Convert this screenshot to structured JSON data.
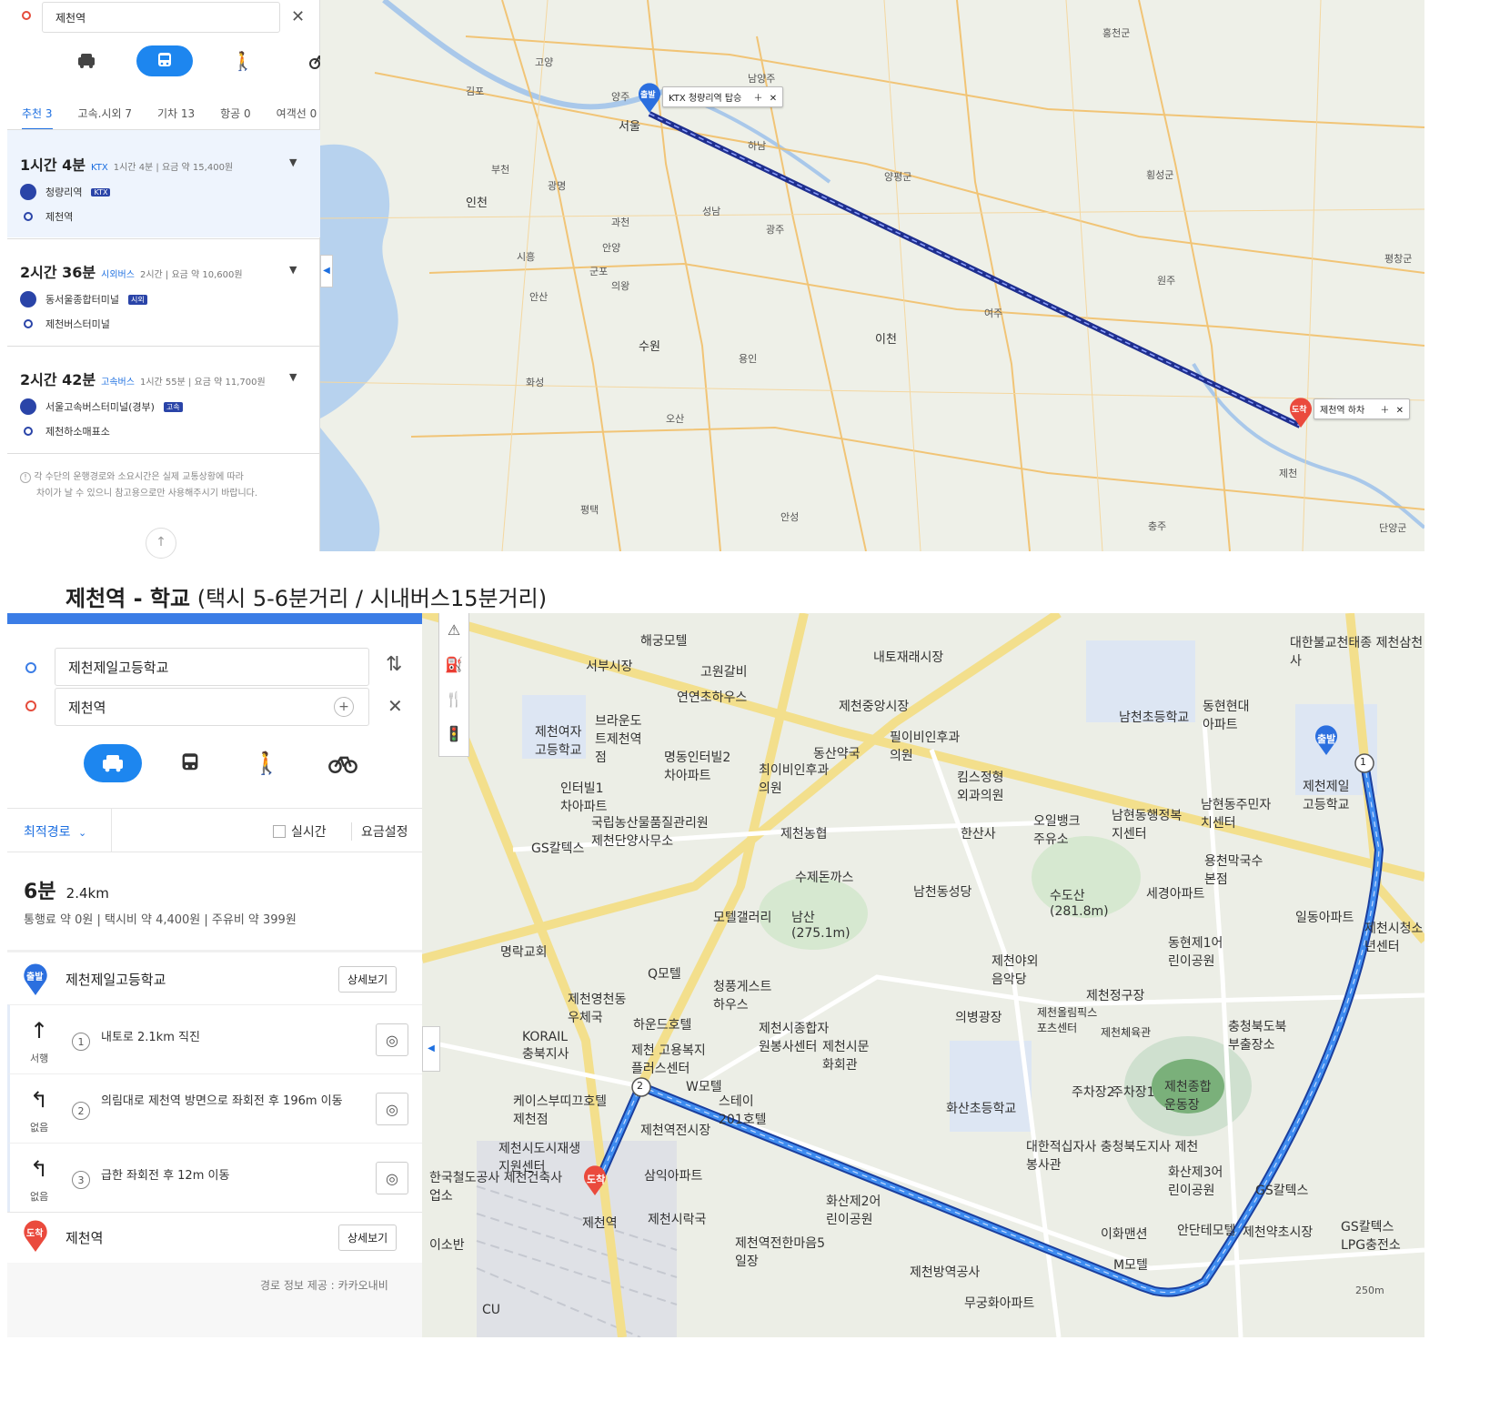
{
  "top": {
    "destination_value": "제천역",
    "tabs": [
      {
        "label": "추천 3"
      },
      {
        "label": "고속.시외 7"
      },
      {
        "label": "기차 13"
      },
      {
        "label": "항공 0"
      },
      {
        "label": "여객선 0"
      }
    ],
    "routes": [
      {
        "time": "1시간 4분",
        "kind": "KTX",
        "detail": "1시간 4분 | 요금 약 15,400원",
        "from": "청량리역",
        "from_badge": "KTX",
        "to": "제천역"
      },
      {
        "time": "2시간 36분",
        "kind": "시외버스",
        "detail": "2시간 | 요금 약 10,600원",
        "from": "동서울종합터미널",
        "from_badge": "시외",
        "to": "제천버스터미널"
      },
      {
        "time": "2시간 42분",
        "kind": "고속버스",
        "detail": "1시간 55분 | 요금 약 11,700원",
        "from": "서울고속버스터미널(경부)",
        "from_badge": "고속",
        "to": "제천하소매표소"
      }
    ],
    "notice_1": "각 수단의 운행경로와 소요시간은 실제 교통상황에 따라",
    "notice_2": "차이가 날 수 있으니 참고용으로만 사용해주시기 바랍니다.",
    "map": {
      "start_pin": "출발",
      "start_tag": "KTX 청량리역 탑승",
      "end_pin": "도착",
      "end_tag": "제천역 하차",
      "labels": [
        "서울",
        "인천",
        "김포",
        "고양",
        "남양주",
        "하남",
        "성남",
        "과천",
        "안양",
        "광명",
        "부천",
        "시흥",
        "군포",
        "의왕",
        "수원",
        "안산",
        "화성",
        "오산",
        "용인",
        "광주",
        "이천",
        "여주",
        "양평군",
        "원주",
        "홍천군",
        "횡성군",
        "평택",
        "안성",
        "충주",
        "단양군",
        "평창군",
        "제천",
        "양주"
      ]
    }
  },
  "heading": {
    "bold": "제천역 - 학교",
    "rest": " (택시 5-6분거리 / 시내버스15분거리)"
  },
  "bottom": {
    "origin_value": "제천제일고등학교",
    "destination_value": "제천역",
    "route_option": "최적경로",
    "realtime_label": "실시간",
    "fare_setting": "요금설정",
    "duration": "6분",
    "distance": "2.4km",
    "costs": "통행료 약 0원 | 택시비 약 4,400원 | 주유비 약 399원",
    "start_pin": "출발",
    "start_name": "제천제일고등학교",
    "detail_button": "상세보기",
    "steps": [
      {
        "num": "1",
        "text": "내토로 2.1km 직진",
        "sub": "서행",
        "arrow": "↑"
      },
      {
        "num": "2",
        "text": "의림대로 제천역 방면으로 좌회전 후 196m 이동",
        "sub": "없음",
        "arrow": "↰"
      },
      {
        "num": "3",
        "text": "급한 좌회전 후 12m 이동",
        "sub": "없음",
        "arrow": "↰"
      }
    ],
    "end_pin": "도착",
    "end_name": "제천역",
    "provider": "경로 정보 제공 : 카카오내비",
    "map": {
      "start_pin": "출발",
      "end_pin": "도착",
      "labels": [
        "해궁모텔",
        "서부시장",
        "고원갈비",
        "내토재래시장",
        "제천중앙시장",
        "필이비인후과의원",
        "연연초하우스",
        "제천여자고등학교",
        "브라운도트제천역점",
        "명동인터빌2차아파트",
        "최이비인후과의원",
        "동산약국",
        "킴스정형외과의원",
        "남천초등학교",
        "동현현대아파트",
        "대한불교천태종 제천삼천사",
        "제천제일고등학교",
        "인터빌1차아파트",
        "국립농산물품질관리원 제천단양사무소",
        "제천농협",
        "한산사",
        "오일뱅크주유소",
        "남현동행정복지센터",
        "남현동주민자치센터",
        "GS칼텍스",
        "수제돈까스",
        "남천동성당",
        "수도산(281.8m)",
        "세경아파트",
        "용천막국수본점",
        "일동아파트",
        "모텔갤러리",
        "남산(275.1m)",
        "동현제1어린이공원",
        "제천시청소년센터",
        "명락교회",
        "Q모텔",
        "청풍게스트하우스",
        "제천야외음악당",
        "제천정구장",
        "의병광장",
        "제천올림픽스포츠센터",
        "제천체육관",
        "충청북도북부출장소",
        "제천영천동우체국",
        "하운드호텔",
        "제천시종합자원봉사센터",
        "KORAIL충북지사",
        "제천 고용복지플러스센터",
        "제천시문화회관",
        "W모텔",
        "스테이201호텔",
        "주차장2",
        "주차장1",
        "제천종합운동장",
        "화산초등학교",
        "케이스부띠끄호텔제천점",
        "제천역전시장",
        "제천시도시재생지원센터",
        "대한적십자사 충청북도지사 제천봉사관",
        "화산제3어린이공원",
        "GS칼텍스",
        "한국철도공사 제천건축사업소",
        "삼익아파트",
        "제천역",
        "제천시락국",
        "화산제2어린이공원",
        "이화맨션",
        "안단테모텔",
        "제천약초시장",
        "GS칼텍스LPG충전소",
        "제천역전한마음5일장",
        "제천방역공사",
        "M모텔",
        "무궁화아파트",
        "이소반",
        "CU",
        "250m"
      ]
    }
  },
  "colors": {
    "accent": "#1d86ef",
    "route_dark": "#1f2f8f",
    "route_blue": "#2d6ee0",
    "pin_red": "#ea4a3d",
    "pin_blue": "#2b6fdf"
  }
}
